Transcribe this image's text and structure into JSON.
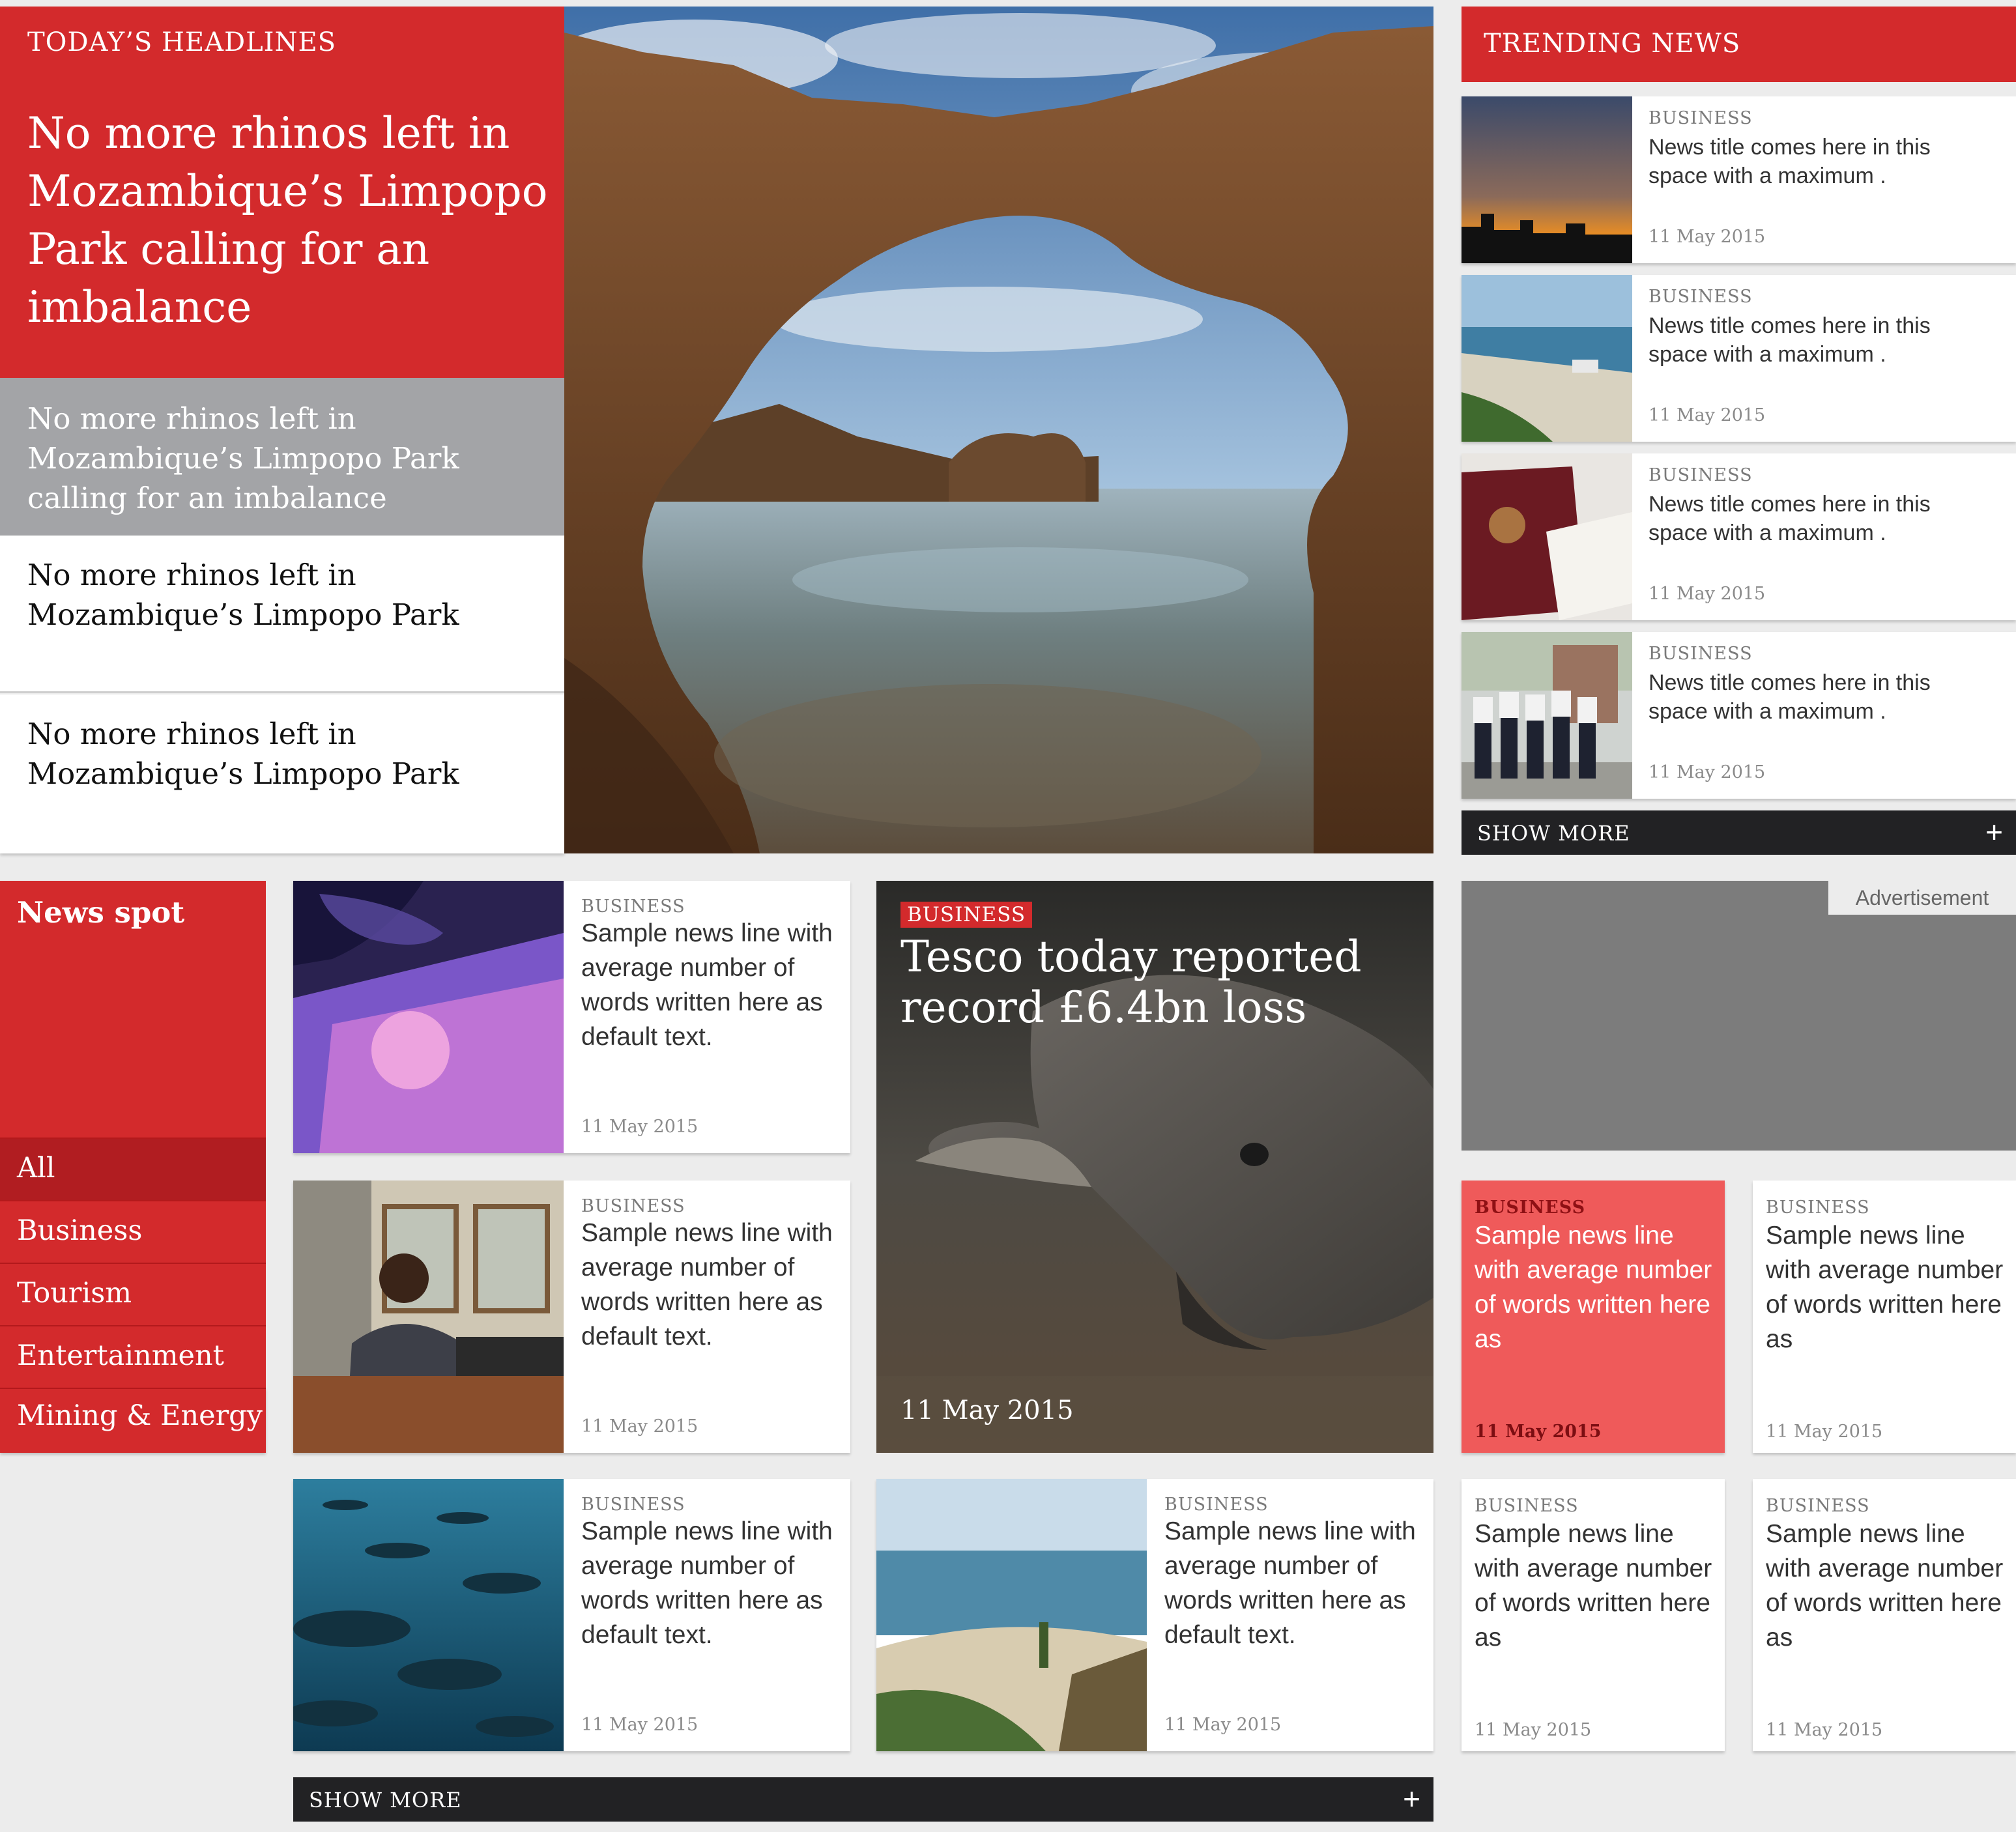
{
  "headlines": {
    "label": "TODAY’S HEADLINES",
    "main_title": "No more rhinos left in Mozambique’s Limpopo Park calling for an imbalance",
    "secondary_title": "No more rhinos left in Mozambique’s Limpopo Park calling for an imbalance",
    "items": [
      "No more rhinos left in Mozambique’s Limpopo Park",
      "No more rhinos left in Mozambique’s Limpopo Park"
    ]
  },
  "trending": {
    "label": "TRENDING NEWS",
    "items": [
      {
        "category": "BUSINESS",
        "title": "News title comes here in this space with a maximum .",
        "date": "11 May 2015",
        "image": "sunset-city"
      },
      {
        "category": "BUSINESS",
        "title": "News title comes here in this space with a maximum .",
        "date": "11 May 2015",
        "image": "beach-shore"
      },
      {
        "category": "BUSINESS",
        "title": "News title comes here in this space with a maximum .",
        "date": "11 May 2015",
        "image": "passport"
      },
      {
        "category": "BUSINESS",
        "title": "News title comes here in this space with a maximum .",
        "date": "11 May 2015",
        "image": "officers"
      }
    ],
    "show_more": "SHOW MORE",
    "plus": "+"
  },
  "news_spot": {
    "title": "News spot",
    "menu": [
      "All",
      "Business",
      "Tourism",
      "Entertainment",
      "Mining & Energy"
    ],
    "active": "All"
  },
  "middle_cards": [
    {
      "category": "BUSINESS",
      "title": "Sample news line with average number of words written here as default text.",
      "date": "11 May 2015",
      "image": "uv-passport"
    },
    {
      "category": "BUSINESS",
      "title": "Sample news line with average number of words written here as default text.",
      "date": "11 May 2015",
      "image": "speaker-podium"
    },
    {
      "category": "BUSINESS",
      "title": "Sample news line with average number of words written here as default text.",
      "date": "11 May 2015",
      "image": "tuna-school"
    },
    {
      "category": "BUSINESS",
      "title": "Sample news line with average number of words written here as default text.",
      "date": "11 May 2015",
      "image": "lake-shore"
    }
  ],
  "feature": {
    "category": "BUSINESS",
    "title": "Tesco today reported record £6.4bn loss",
    "date": "11 May 2015",
    "image": "rhino"
  },
  "advertisement": {
    "label": "Advertisement"
  },
  "small_cards": [
    {
      "category": "BUSINESS",
      "title": "Sample news line with average number of words written here as",
      "date": "11 May 2015",
      "highlight": true
    },
    {
      "category": "BUSINESS",
      "title": "Sample news line with average number of words written here as",
      "date": "11 May 2015",
      "highlight": false
    },
    {
      "category": "BUSINESS",
      "title": "Sample news line with average number of words written here as",
      "date": "11 May 2015",
      "highlight": false
    },
    {
      "category": "BUSINESS",
      "title": "Sample news line with average number of words written here as",
      "date": "11 May 2015",
      "highlight": false
    }
  ],
  "bottom_show_more": "SHOW MORE",
  "bottom_plus": "+",
  "colors": {
    "accent": "#d32a2c",
    "accent_dark": "#b11d21",
    "highlight_card": "#ef5a5a",
    "gray_block": "#a3a4a7",
    "dark_bar": "#222224",
    "ad_bg": "#7c7c7c"
  }
}
